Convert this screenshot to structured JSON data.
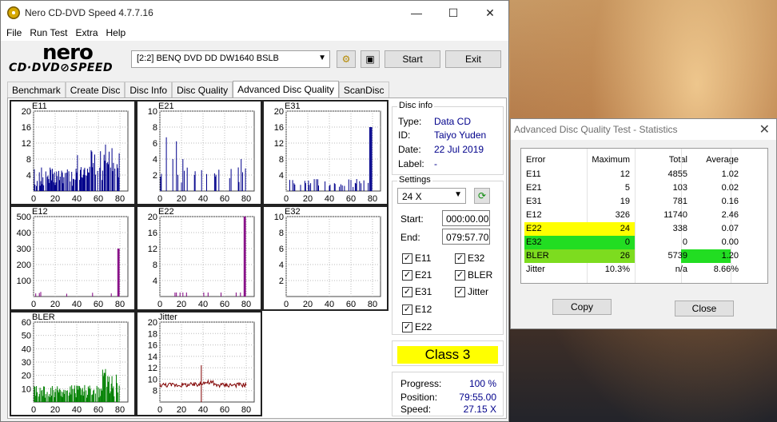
{
  "window": {
    "title": "Nero CD-DVD Speed 4.7.7.16",
    "controls": {
      "minimize": "—",
      "maximize": "☐",
      "close": "✕"
    }
  },
  "menu": [
    "File",
    "Run Test",
    "Extra",
    "Help"
  ],
  "logo": {
    "nero": "nero",
    "sub": "CD·DVD⊘SPEED"
  },
  "toolbar": {
    "drive": "[2:2]   BENQ DVD DD DW1640 BSLB",
    "start_label": "Start",
    "exit_label": "Exit"
  },
  "tabs": [
    "Benchmark",
    "Create Disc",
    "Disc Info",
    "Disc Quality",
    "Advanced Disc Quality",
    "ScanDisc"
  ],
  "active_tab": "Advanced Disc Quality",
  "disc_info": {
    "title": "Disc info",
    "type_label": "Type:",
    "type": "Data CD",
    "id_label": "ID:",
    "id": "Taiyo Yuden",
    "date_label": "Date:",
    "date": "22 Jul 2019",
    "label_label": "Label:",
    "label": "-"
  },
  "settings": {
    "title": "Settings",
    "speed": "24 X",
    "start_label": "Start:",
    "start": "000:00.00",
    "end_label": "End:",
    "end": "079:57.70",
    "checks": {
      "E11": "E11",
      "E32": "E32",
      "E21": "E21",
      "BLER": "BLER",
      "E31": "E31",
      "Jitter": "Jitter",
      "E12": "E12",
      "E22": "E22"
    }
  },
  "class_label": "Class 3",
  "progress": {
    "progress_label": "Progress:",
    "progress": "100 %",
    "position_label": "Position:",
    "position": "79:55.00",
    "speed_label": "Speed:",
    "speed": "27.15 X"
  },
  "chart_data": [
    {
      "type": "bar",
      "title": "E11",
      "x_ticks": [
        "0",
        "20",
        "40",
        "60",
        "80"
      ],
      "y_ticks": [
        "20",
        "16",
        "12",
        "8",
        "4"
      ],
      "ylim": [
        0,
        20
      ],
      "color": "#00008b",
      "values_summary": "dense activity across 0-80 min, mostly 2-8, peaks ~12 near 65-78 min"
    },
    {
      "type": "bar",
      "title": "E21",
      "x_ticks": [
        "0",
        "20",
        "40",
        "60",
        "80"
      ],
      "y_ticks": [
        "10",
        "8",
        "6",
        "4",
        "2"
      ],
      "ylim": [
        0,
        10
      ],
      "color": "#00008b"
    },
    {
      "type": "bar",
      "title": "E31",
      "x_ticks": [
        "0",
        "20",
        "40",
        "60",
        "80"
      ],
      "y_ticks": [
        "20",
        "16",
        "12",
        "8",
        "4"
      ],
      "ylim": [
        0,
        20
      ],
      "color": "#00008b"
    },
    {
      "type": "bar",
      "title": "E12",
      "x_ticks": [
        "0",
        "20",
        "40",
        "60",
        "80"
      ],
      "y_ticks": [
        "500",
        "400",
        "300",
        "200",
        "100"
      ],
      "ylim": [
        0,
        500
      ],
      "color": "#800080"
    },
    {
      "type": "bar",
      "title": "E22",
      "x_ticks": [
        "0",
        "20",
        "40",
        "60",
        "80"
      ],
      "y_ticks": [
        "20",
        "16",
        "12",
        "8",
        "4"
      ],
      "ylim": [
        0,
        20
      ],
      "color": "#800080"
    },
    {
      "type": "bar",
      "title": "E32",
      "x_ticks": [
        "0",
        "20",
        "40",
        "60",
        "80"
      ],
      "y_ticks": [
        "10",
        "8",
        "6",
        "4",
        "2"
      ],
      "ylim": [
        0,
        10
      ],
      "color": "#800080"
    },
    {
      "type": "bar",
      "title": "BLER",
      "x_ticks": [
        "0",
        "20",
        "40",
        "60",
        "80"
      ],
      "y_ticks": [
        "60",
        "50",
        "40",
        "30",
        "20",
        "10"
      ],
      "ylim": [
        0,
        60
      ],
      "color": "#008000"
    },
    {
      "type": "line",
      "title": "Jitter",
      "x_ticks": [
        "0",
        "20",
        "40",
        "60",
        "80"
      ],
      "y_ticks": [
        "20",
        "18",
        "16",
        "14",
        "12",
        "10",
        "8"
      ],
      "ylim": [
        6,
        20
      ],
      "color": "#800000"
    }
  ],
  "stats_dialog": {
    "title": "Advanced Disc Quality Test - Statistics",
    "headers": [
      "Error",
      "Maximum",
      "Total",
      "Average"
    ],
    "rows": [
      {
        "name": "E11",
        "max": "12",
        "total": "4855",
        "avg": "1.02"
      },
      {
        "name": "E21",
        "max": "5",
        "total": "103",
        "avg": "0.02"
      },
      {
        "name": "E31",
        "max": "19",
        "total": "781",
        "avg": "0.16"
      },
      {
        "name": "E12",
        "max": "326",
        "total": "11740",
        "avg": "2.46"
      },
      {
        "name": "E22",
        "max": "24",
        "total": "338",
        "avg": "0.07"
      },
      {
        "name": "E32",
        "max": "0",
        "total": "0",
        "avg": "0.00"
      },
      {
        "name": "BLER",
        "max": "26",
        "total": "5739",
        "avg": "1.20"
      },
      {
        "name": "Jitter",
        "max": "10.3%",
        "total": "n/a",
        "avg": "8.66%"
      }
    ],
    "copy_label": "Copy",
    "close_label": "Close"
  }
}
